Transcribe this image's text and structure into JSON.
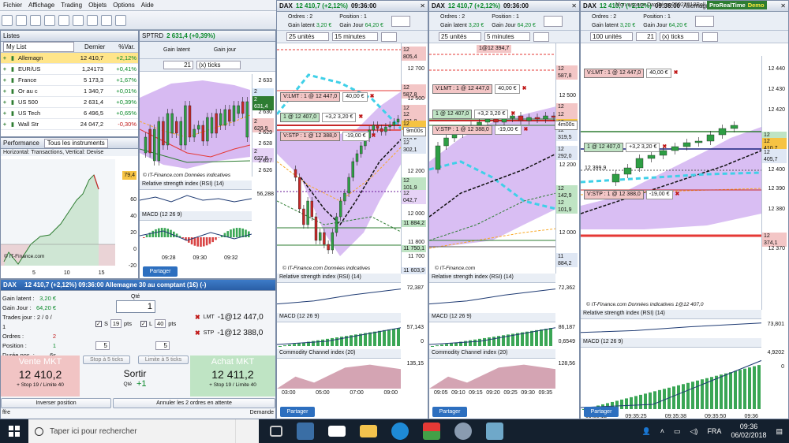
{
  "platform": {
    "menu": [
      "Fichier",
      "Affichage",
      "Trading",
      "Objets",
      "Options",
      "Aide"
    ],
    "right_title": "Mon espace DaxDémo05022018Boll",
    "brand": "ProRealTime",
    "brand_mode": "Demo"
  },
  "lists": {
    "title": "Listes",
    "list_name": "My List",
    "col_last": "Dernier",
    "col_var": "%Var.",
    "rows": [
      {
        "name": "Allemagn",
        "last": "12 410,7",
        "var": "+2,12%",
        "up": true
      },
      {
        "name": "EUR/US",
        "last": "1,24173",
        "var": "+0,41%",
        "up": true
      },
      {
        "name": "France",
        "last": "5 173,3",
        "var": "+1,67%",
        "up": true
      },
      {
        "name": "Or au c",
        "last": "1 340,7",
        "var": "+0,01%",
        "up": true
      },
      {
        "name": "US 500",
        "last": "2 631,4",
        "var": "+0,39%",
        "up": true
      },
      {
        "name": "US Tech",
        "last": "6 496,5",
        "var": "+0,65%",
        "up": true
      },
      {
        "name": "Wall Str",
        "last": "24 047,2",
        "var": "-0,30%",
        "up": false
      }
    ]
  },
  "performance": {
    "title": "Performance",
    "filter": "Tous les instruments",
    "subtitle": "Horizontal: Transactions, Vertical: Devise",
    "copyright": "© IT-Finance.com",
    "yticks": [
      "80",
      "60",
      "40",
      "20",
      "0",
      "-20"
    ],
    "xticks": [
      "5",
      "10",
      "15"
    ],
    "value_tag": "79,4"
  },
  "sptrd": {
    "title": "SPTRD",
    "price": "2 631,4 (+0,39%)",
    "gain": "Gain latent",
    "gain_day": "Gain jour",
    "ticks_value": "21",
    "ticks_unit": "(x) ticks",
    "copyright": "© IT-Finance.com  Données indicatives",
    "rsi": "Relative strength index (RSI) (14)",
    "macd": "MACD (12 26 9)",
    "prices": [
      "2 633",
      "2 632,0",
      "2 631,4",
      "2 630",
      "2 629,9",
      "2 629",
      "2 628",
      "2 627,8",
      "2 627",
      "2 626"
    ],
    "rsi_tag": "56,288",
    "times": [
      "09:28",
      "09:30",
      "09:32"
    ],
    "partager": "Partager"
  },
  "order": {
    "title": "DAX",
    "header": "12 410,7 (+2,12%)  09:36:00  Allemagne 30 au comptant (1€) (-)",
    "gain_latent": "Gain latent :",
    "gain_latent_v": "3,20 €",
    "gain_jour": "Gain Jour :",
    "gain_jour_v": "64,20 €",
    "trades": "Trades jour : 2 / 0 / 1",
    "ordres": "Ordres :",
    "ordres_v": "2",
    "position": "Position :",
    "position_v": "1",
    "duree": "Durée pos. :",
    "duree_v": "6s",
    "qte_label": "Qté",
    "qte": "1",
    "s_label": "S",
    "s_val": "19",
    "l_label": "L",
    "l_val": "40",
    "pts": "pts",
    "lmt": "LMT",
    "lmt_v": "-1@12 447,0",
    "stp": "STP",
    "stp_v": "-1@12 388,0",
    "stop5": "Stop à 5 ticks",
    "limit5": "Limite à 5 ticks",
    "five": "5",
    "sell_label": "Vente MKT",
    "sell_price": "12 410,2",
    "sell_sub": "+ Stop 19 / Limite 40",
    "exit_label": "Sortir",
    "exit_qty_label": "Qté",
    "exit_qty": "+1",
    "buy_label": "Achat MKT",
    "buy_price": "12 411,2",
    "buy_sub": "+ Stop 19 / Limite 40",
    "invert": "Inverser position",
    "cancel": "Annuler les 2 ordres en attente",
    "offre": "ffre",
    "demande": "Demande"
  },
  "charts": [
    {
      "title": "DAX",
      "price": "12 410,7 (+2,12%)",
      "time": "09:36:00",
      "ordres": "Ordres : 2",
      "position": "Position : 1",
      "gain_latent": "Gain latent",
      "gain_latent_v": "3,20 €",
      "gain_jour": "Gain Jour",
      "gain_jour_v": "64,20 €",
      "units": "25 unités",
      "interval": "15 minutes",
      "lmt": "V:LMT : 1 @ 12 447,0",
      "lmt_gain": "40,00 €",
      "pos": "1 @ 12 407,0",
      "pos_gain": "+3,2   3,20 €",
      "stp": "V:STP : 1 @ 12 388,0",
      "stp_gain": "-19,00 €",
      "timer": "9m00s",
      "prices": [
        "12 805,4",
        "12 700",
        "12 600",
        "12 587,8",
        "12 500",
        "12 453,6",
        "12 431,8",
        "12 410,7",
        "12 319,5",
        "12 302,1",
        "12 200",
        "12 101,9",
        "12 042,7",
        "12 000",
        "11 884,2",
        "11 800",
        "11 750,1",
        "11 700",
        "11 603,9"
      ],
      "times": [
        "03:00",
        "05:00",
        "07:00",
        "09:00"
      ],
      "rsi": "Relative strength index (RSI) (14)",
      "rsi_tag": "72,387",
      "macd": "MACD (12 26 9)",
      "macd_tags": [
        "57,143",
        "0"
      ],
      "cci": "Commodity Channel index (20)",
      "cci_tag": "135,15",
      "copyright": "© IT-Finance.com  Données indicatives",
      "partager": "Partager"
    },
    {
      "title": "DAX",
      "price": "12 410,7 (+2,12%)",
      "time": "09:36:00",
      "ordres": "Ordres : 2",
      "position": "Position : 1",
      "gain_latent": "Gain latent",
      "gain_latent_v": "3,20 €",
      "gain_jour": "Gain Jour",
      "gain_jour_v": "64,20 €",
      "units": "25 unités",
      "interval": "5 minutes",
      "lmt": "V:LMT : 1 @ 12 447,0",
      "lmt_gain": "40,00 €",
      "pos": "1 @ 12 407,0",
      "pos_gain": "+3,2   3,20 €",
      "stp": "V:STP : 1 @ 12 388,0",
      "stp_gain": "-19,00 €",
      "timer": "4m00s",
      "prices": [
        "12 587,8",
        "12 500",
        "12 453,6",
        "12 441,2",
        "12 410,7",
        "12 319,5",
        "12 292,0",
        "12 200",
        "12 142,9",
        "12 101,9",
        "12 000",
        "11 884,2"
      ],
      "topline": "1@12 394,7",
      "times": [
        "09:05",
        "09:10",
        "09:15",
        "09:20",
        "09:25",
        "09:30",
        "09:35"
      ],
      "rsi": "Relative strength index (RSI) (14)",
      "rsi_tag": "72,362",
      "macd": "MACD (12 26 9)",
      "macd_tags": [
        "86,187",
        "0,6549"
      ],
      "cci": "Commodity Channel index (20)",
      "cci_tag": "128,56",
      "copyright": "© IT-Finance.com",
      "partager": "Partager"
    },
    {
      "title": "DAX",
      "price": "12 410,7 (+2,12%)",
      "time": "09:36:00",
      "header_more": "Allemagne 30 au compt",
      "ordres": "Ordres : 2",
      "position": "Position : 1",
      "gain_latent": "Gain latent",
      "gain_latent_v": "3,20 €",
      "gain_jour": "Gain Jour",
      "gain_jour_v": "64,20 €",
      "units": "100 unités",
      "interval": "21",
      "interval_unit": "(x) ticks",
      "lmt": "V:LMT : 1 @ 12 447,0",
      "lmt_gain": "40,00 €",
      "pos": "1 @ 12 407,0",
      "pos_gain": "+3,2   3,20 €",
      "stp": "V:STP : 1 @ 12 388,0",
      "stp_gain": "-19,00 €",
      "prices": [
        "12 440",
        "12 430",
        "12 420",
        "12 413,1",
        "12 410,7",
        "12 405,7",
        "12 400",
        "12 390",
        "12 380",
        "12 374,1",
        "12 370"
      ],
      "left_label": "12 399,9",
      "times": [
        "09:35:12",
        "09:35:25",
        "09:35:38",
        "09:35:50",
        "09:36"
      ],
      "rsi": "Relative strength index (RSI) (14)",
      "rsi_tag": "73,801",
      "macd": "MACD (12 26 9)",
      "macd_tags": [
        "4,9202",
        "0"
      ],
      "copyright": "© IT-Finance.com  Données indicatives   1@12 407,0",
      "partager": "Partager"
    }
  ],
  "taskbar": {
    "search": "Taper ici pour rechercher",
    "lang": "FRA",
    "time": "09:36",
    "date": "06/02/2018"
  },
  "colors": {
    "green": "#0a8a2a",
    "red": "#c01818",
    "band": "#c9a3ee",
    "accent": "#2d6fbf"
  }
}
